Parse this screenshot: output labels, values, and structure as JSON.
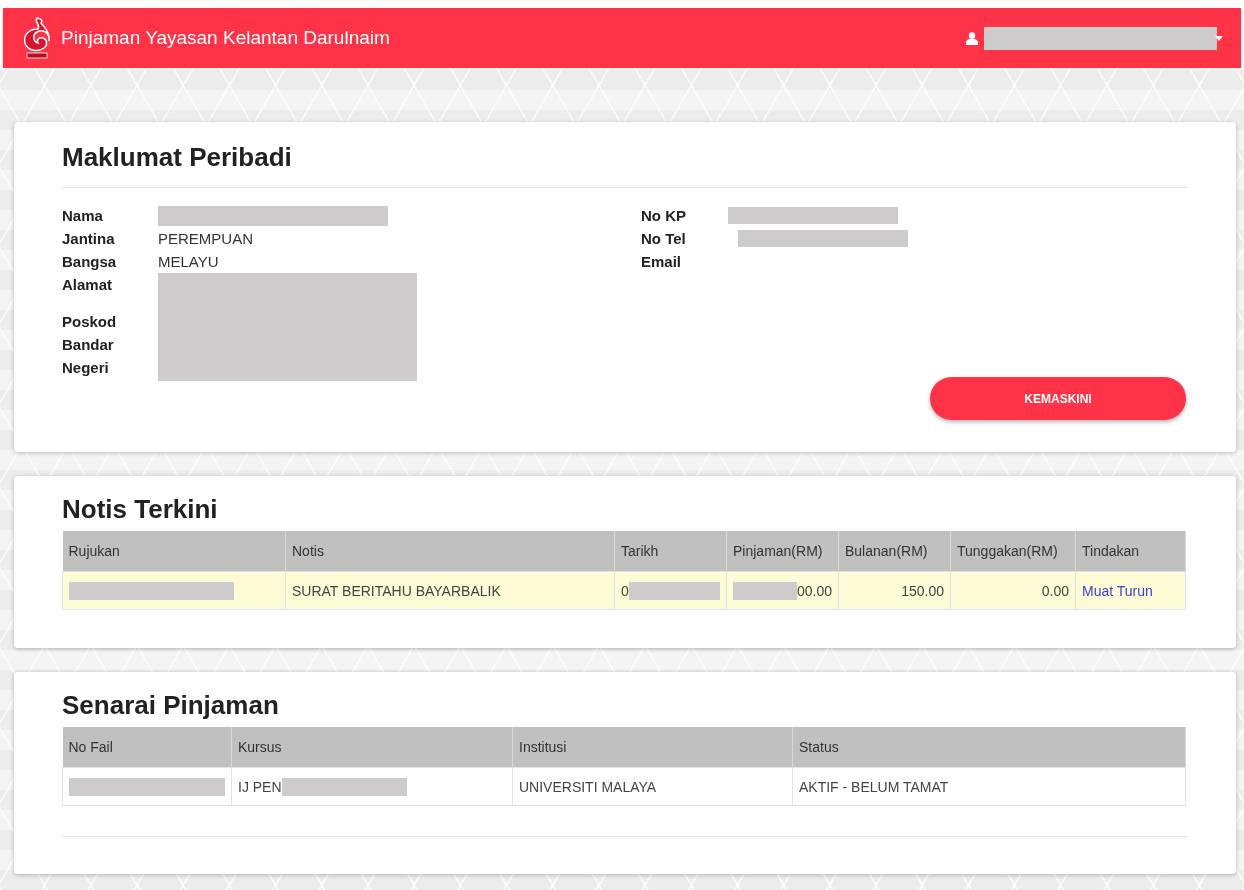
{
  "header": {
    "title": "Pinjaman Yayasan Kelantan Darulnaim",
    "user": {
      "redacted": true
    }
  },
  "profile": {
    "title": "Maklumat Peribadi",
    "left_fields": [
      {
        "label": "Nama",
        "redacted": true
      },
      {
        "label": "Jantina",
        "value": "PEREMPUAN"
      },
      {
        "label": "Bangsa",
        "value": "MELAYU"
      }
    ],
    "address": {
      "labels": [
        "Alamat",
        "Poskod",
        "Bandar",
        "Negeri"
      ],
      "redacted": true
    },
    "right_fields": [
      {
        "label": "No KP",
        "redacted": true
      },
      {
        "label": "No Tel",
        "redacted": true
      },
      {
        "label": "Email"
      }
    ],
    "button": "KEMASKINI"
  },
  "notices": {
    "title": "Notis Terkini",
    "columns": [
      {
        "label": "Rujukan",
        "kind": "text"
      },
      {
        "label": "Notis",
        "kind": "text"
      },
      {
        "label": "Tarikh",
        "kind": "text"
      },
      {
        "label": "Pinjaman(RM)",
        "kind": "number"
      },
      {
        "label": "Bulanan(RM)",
        "kind": "number"
      },
      {
        "label": "Tunggakan(RM)",
        "kind": "number"
      },
      {
        "label": "Tindakan",
        "kind": "link"
      }
    ],
    "rows": [
      {
        "highlighted": true,
        "cells": [
          {
            "redacted": true
          },
          {
            "text": "SURAT BERITAHU BAYARBALIK"
          },
          {
            "text": "0",
            "redacted": true
          },
          {
            "text": "00.00",
            "redacted": true
          },
          {
            "text": "150.00"
          },
          {
            "text": "0.00"
          },
          {
            "text": "Muat Turun"
          }
        ]
      }
    ]
  },
  "loans": {
    "title": "Senarai Pinjaman",
    "columns": [
      {
        "label": "No Fail",
        "kind": "text"
      },
      {
        "label": "Kursus",
        "kind": "text"
      },
      {
        "label": "Institusi",
        "kind": "text"
      },
      {
        "label": "Status",
        "kind": "text"
      }
    ],
    "rows": [
      {
        "highlighted": false,
        "cells": [
          {
            "redacted": true
          },
          {
            "text": "IJ PEN",
            "redacted": true
          },
          {
            "text": "UNIVERSITI MALAYA"
          },
          {
            "text": "AKTIF - BELUM TAMAT"
          }
        ]
      }
    ]
  }
}
